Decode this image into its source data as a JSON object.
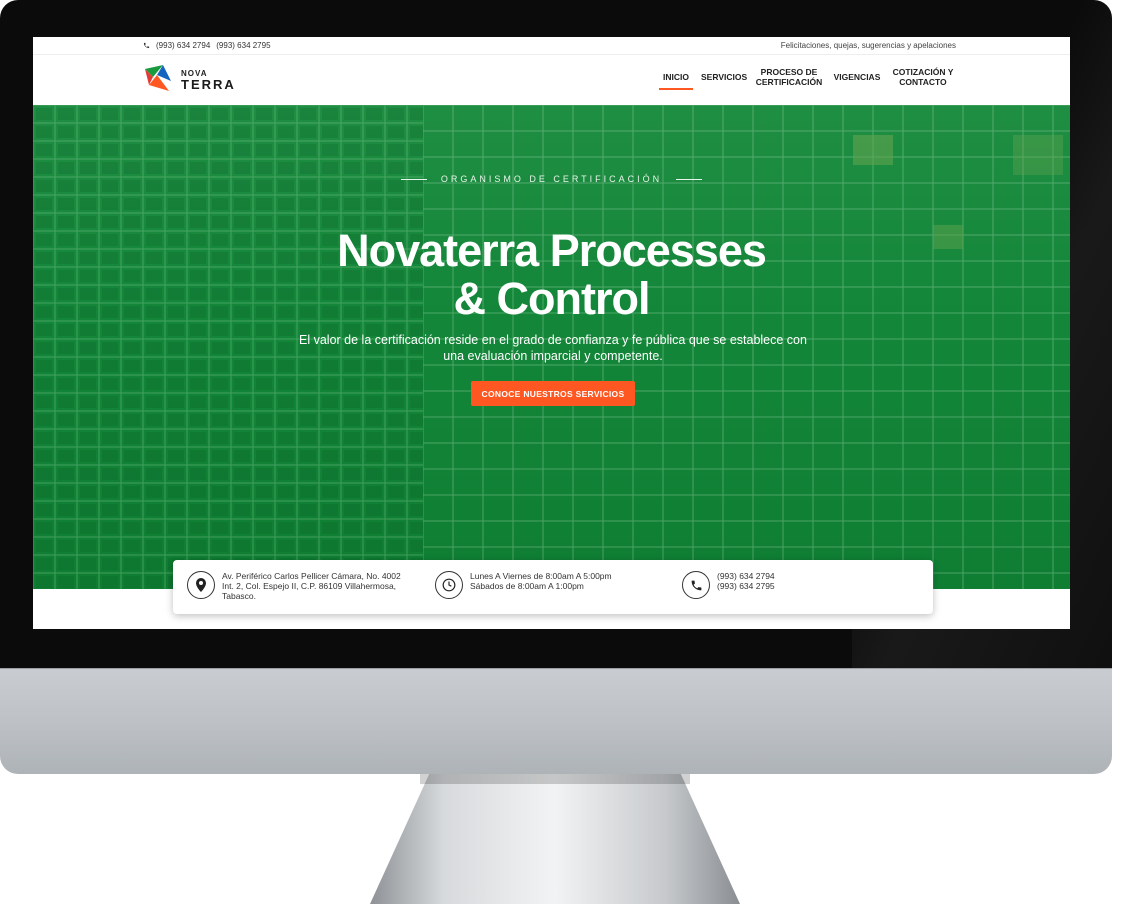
{
  "topbar": {
    "phone1": "(993) 634 2794",
    "phone2": "(993) 634 2795",
    "feedback_link": "Felicitaciones, quejas, sugerencias y apelaciones"
  },
  "brand": {
    "logo_top": "NOVA",
    "logo_bottom": "TERRA"
  },
  "nav": {
    "items": [
      {
        "label": "INICIO",
        "active": true
      },
      {
        "label": "SERVICIOS"
      },
      {
        "label": "PROCESO DE CERTIFICACIÓN"
      },
      {
        "label": "VIGENCIAS"
      },
      {
        "label": "COTIZACIÓN Y CONTACTO"
      }
    ]
  },
  "hero": {
    "tagline": "ORGANISMO DE CERTIFICACIÓN",
    "title_line1": "Novaterra Processes",
    "title_line2": "& Control",
    "subtitle": "El valor de la certificación reside en el grado de confianza y fe pública que se establece con una evaluación imparcial y competente.",
    "cta": "CONOCE NUESTROS SERVICIOS"
  },
  "info": {
    "address": [
      "Av. Periférico Carlos Pellicer Cámara, No. 4002",
      "Int. 2, Col. Espejo II, C.P. 86109 Villahermosa,",
      "Tabasco."
    ],
    "hours": [
      "Lunes A Viernes de 8:00am A 5:00pm",
      "Sábados de 8:00am A 1:00pm"
    ],
    "phones": [
      "(993) 634 2794",
      "(993) 634 2795"
    ]
  },
  "colors": {
    "accent": "#ff5722",
    "hero_green": "#138639"
  },
  "icons": [
    "phone-icon",
    "map-pin-icon",
    "clock-icon"
  ]
}
